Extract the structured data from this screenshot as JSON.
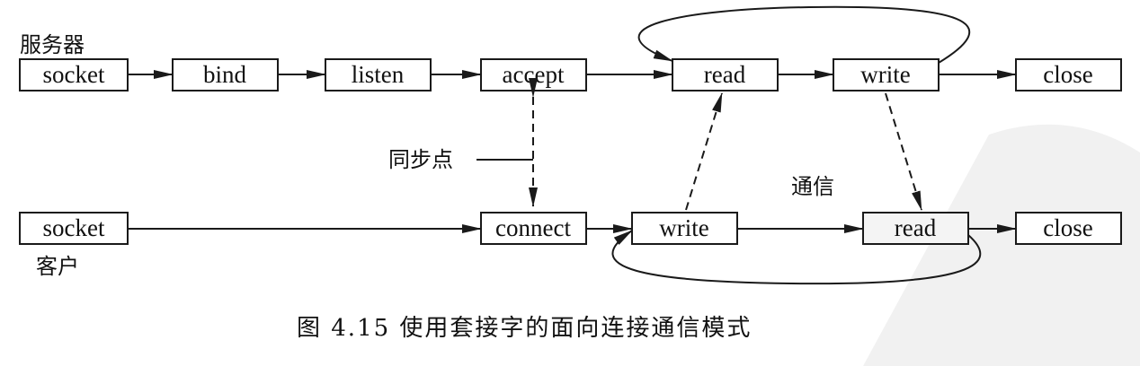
{
  "labels": {
    "server": "服务器",
    "client": "客户",
    "sync_point": "同步点",
    "communication": "通信"
  },
  "server_row": [
    "socket",
    "bind",
    "listen",
    "accept",
    "read",
    "write",
    "close"
  ],
  "client_row": [
    "socket",
    "connect",
    "write",
    "read",
    "close"
  ],
  "caption": "图 4.15  使用套接字的面向连接通信模式",
  "colors": {
    "line": "#1a1a1a",
    "watermark": "#d9d9d9"
  }
}
